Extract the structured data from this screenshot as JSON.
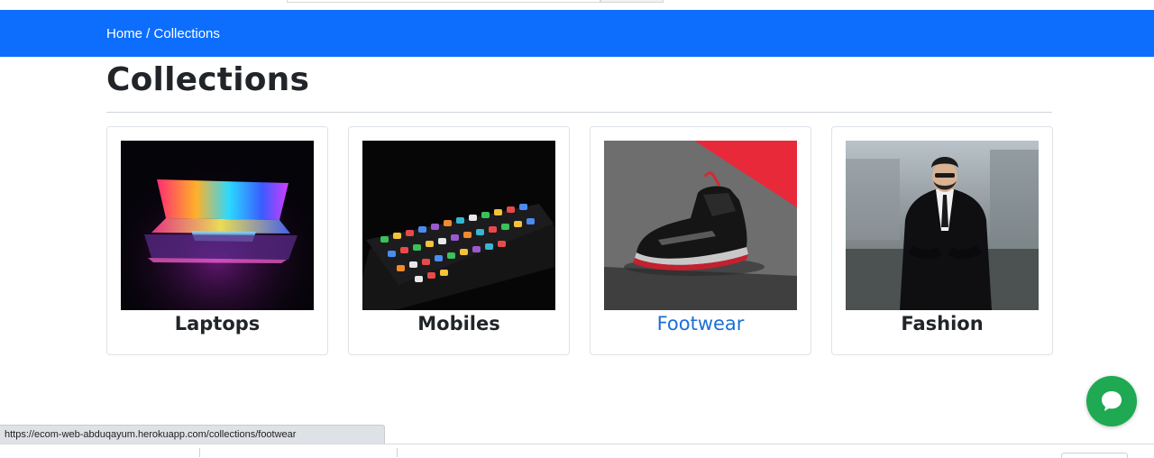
{
  "breadcrumb": {
    "text": "Home / Collections",
    "items": [
      "Home",
      "Collections"
    ]
  },
  "page": {
    "title": "Collections"
  },
  "collections": [
    {
      "name": "Laptops",
      "image": "laptop-photo"
    },
    {
      "name": "Mobiles",
      "image": "mobile-phone-photo"
    },
    {
      "name": "Footwear",
      "image": "sneaker-photo",
      "hovered": true
    },
    {
      "name": "Fashion",
      "image": "man-in-suit-photo"
    }
  ],
  "status_bar": {
    "url": "https://ecom-web-abduqayum.herokuapp.com/collections/footwear"
  },
  "chat": {
    "icon": "chat-bubble-icon"
  },
  "colors": {
    "primary": "#0d6efd",
    "link": "#1c6fd6",
    "chat": "#1ea952"
  }
}
